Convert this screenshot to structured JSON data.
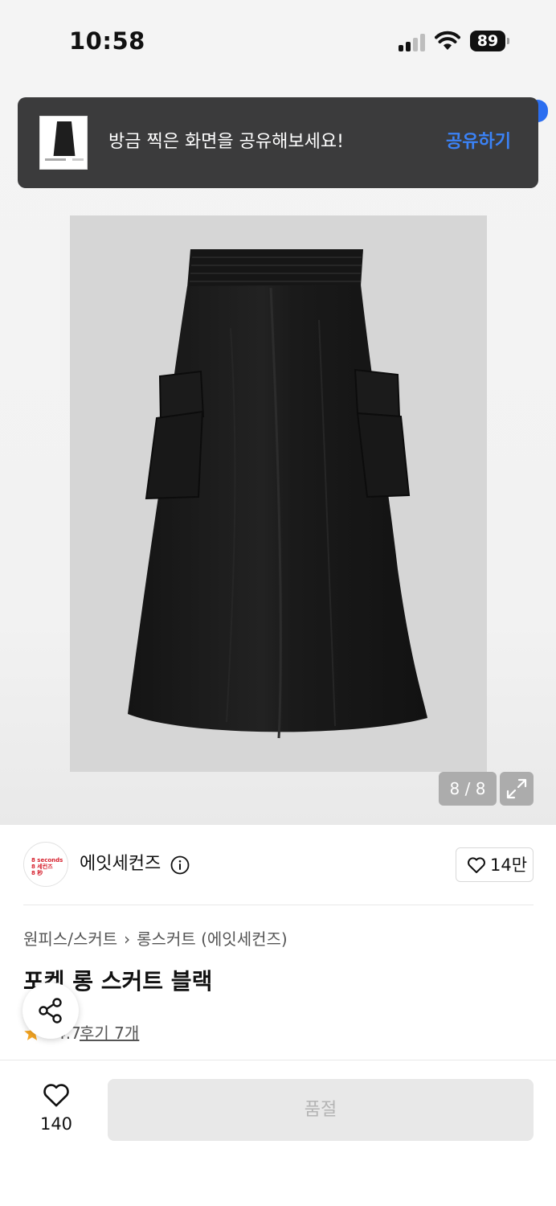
{
  "status_bar": {
    "time": "10:58",
    "battery": "89"
  },
  "toast": {
    "message": "방금 찍은 화면을 공유해보세요!",
    "action": "공유하기"
  },
  "gallery": {
    "counter": "8 / 8",
    "background_color": "#d6d6d6",
    "product_color": "#1c1c1c"
  },
  "brand": {
    "name": "에잇세컨즈",
    "logo_lines": [
      "8 seconds",
      "8 세컨즈",
      "8 秒"
    ],
    "likes": "14만"
  },
  "product": {
    "breadcrumb": [
      "원피스/스커트",
      "롱스커트 (에잇세컨즈)"
    ],
    "breadcrumb_separator": "›",
    "title": "포켓 롱 스커트 블랙",
    "rating": "4.7",
    "reviews": "후기 7개"
  },
  "bottom_bar": {
    "wish_count": "140",
    "soldout_label": "품절"
  },
  "colors": {
    "accent_blue": "#3b82f6",
    "brand_red": "#d61f2c",
    "star_orange": "#f5a623"
  }
}
